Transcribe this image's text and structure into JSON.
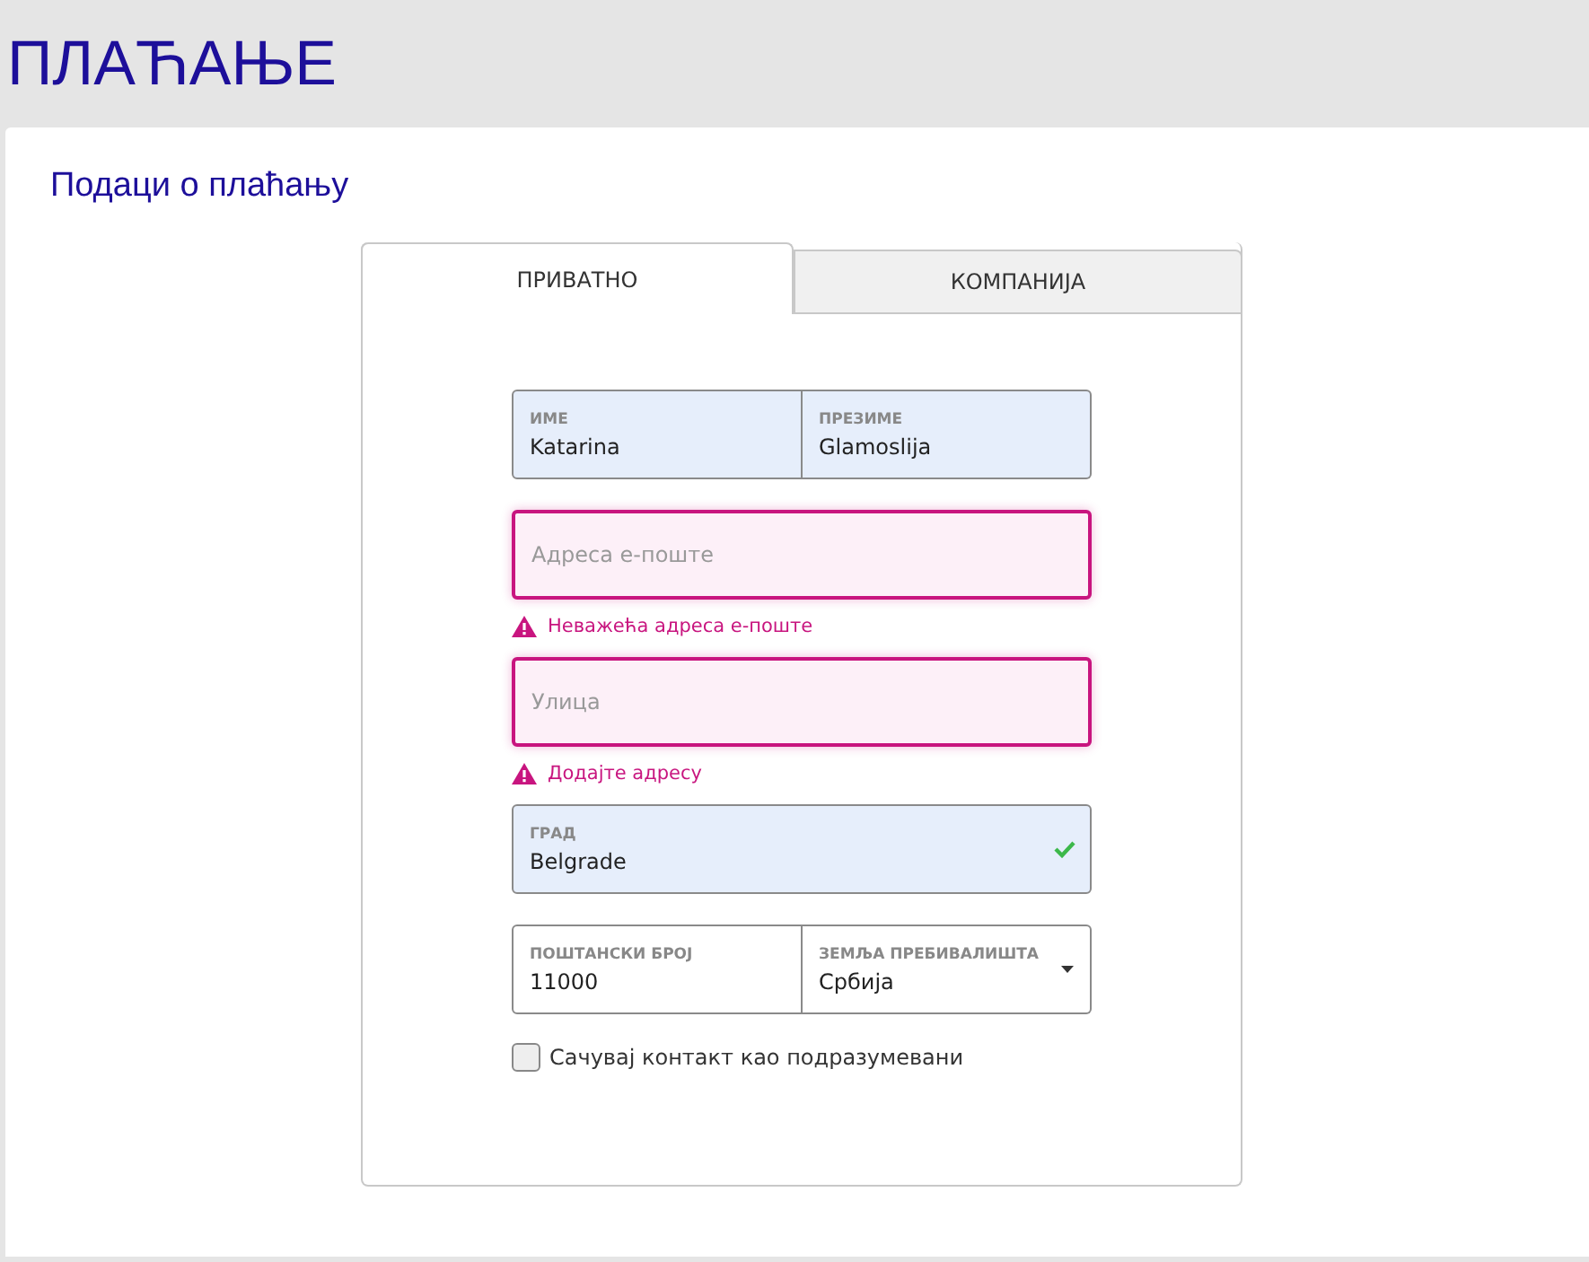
{
  "page_title": "ПЛАЋАЊЕ",
  "section_title": "Подаци о плаћању",
  "tabs": [
    {
      "label": "ПРИВАТНО",
      "selected": true
    },
    {
      "label": "КОМПАНИЈА",
      "selected": false
    }
  ],
  "form": {
    "rows": [
      {
        "fields": [
          {
            "kind": "text",
            "filled": true,
            "invalid": false,
            "valid": false,
            "label": "ИМЕ",
            "value": "Katarina"
          },
          {
            "kind": "text",
            "filled": true,
            "invalid": false,
            "valid": false,
            "label": "ПРЕЗИМЕ",
            "value": "Glamoslija"
          }
        ]
      },
      {
        "fields": [
          {
            "kind": "text",
            "filled": false,
            "invalid": true,
            "valid": false,
            "placeholder": "Адреса е-поште"
          }
        ],
        "error": "Неважећа адреса е-поште"
      },
      {
        "fields": [
          {
            "kind": "text",
            "filled": false,
            "invalid": true,
            "valid": false,
            "placeholder": "Улица"
          }
        ],
        "error": "Додајте адресу"
      },
      {
        "fields": [
          {
            "kind": "text",
            "filled": true,
            "invalid": false,
            "valid": true,
            "label": "ГРАД",
            "value": "Belgrade"
          }
        ]
      },
      {
        "fields": [
          {
            "kind": "text",
            "filled": false,
            "invalid": false,
            "valid": false,
            "label": "ПОШТАНСКИ БРОЈ",
            "value": "11000"
          },
          {
            "kind": "select",
            "filled": false,
            "invalid": false,
            "valid": false,
            "label": "ЗЕМЉА ПРЕБИВАЛИШТА",
            "value": "Србија"
          }
        ]
      }
    ],
    "save_default": {
      "label": "Сачувај контакт као подразумевани",
      "checked": false
    }
  }
}
